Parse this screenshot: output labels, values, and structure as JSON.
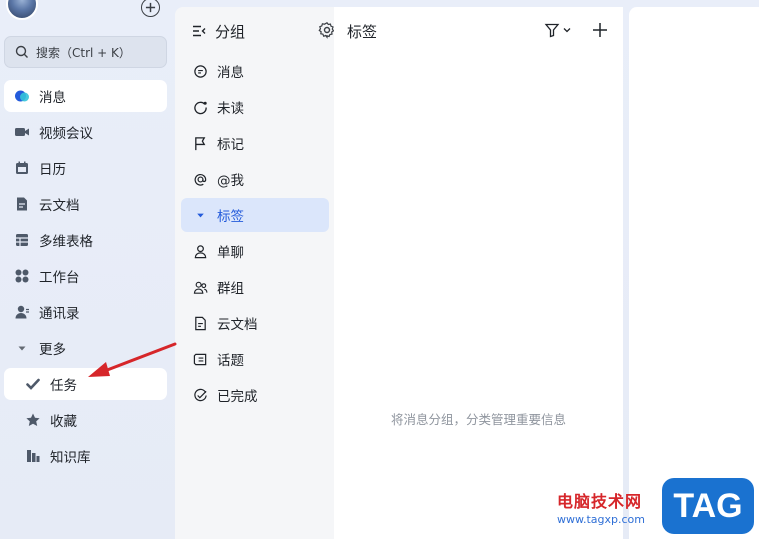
{
  "sidebar": {
    "search_placeholder": "搜索（Ctrl + K）",
    "items": [
      {
        "label": "消息",
        "icon": "message-bubble-icon"
      },
      {
        "label": "视频会议",
        "icon": "video-camera-icon"
      },
      {
        "label": "日历",
        "icon": "calendar-icon"
      },
      {
        "label": "云文档",
        "icon": "cloud-doc-icon"
      },
      {
        "label": "多维表格",
        "icon": "table-icon"
      },
      {
        "label": "工作台",
        "icon": "workspace-grid-icon"
      },
      {
        "label": "通讯录",
        "icon": "contacts-icon"
      },
      {
        "label": "更多",
        "icon": "triangle-down-icon"
      },
      {
        "label": "任务",
        "icon": "checkmark-task-icon"
      },
      {
        "label": "收藏",
        "icon": "star-icon"
      },
      {
        "label": "知识库",
        "icon": "knowledge-base-icon"
      }
    ]
  },
  "groups": {
    "title": "分组",
    "items": [
      {
        "label": "消息",
        "icon": "chat-icon"
      },
      {
        "label": "未读",
        "icon": "unread-circle-icon"
      },
      {
        "label": "标记",
        "icon": "flag-icon"
      },
      {
        "label": "@我",
        "icon": "at-icon"
      },
      {
        "label": "标签",
        "icon": "triangle-down-icon"
      },
      {
        "label": "单聊",
        "icon": "person-icon"
      },
      {
        "label": "群组",
        "icon": "group-people-icon"
      },
      {
        "label": "云文档",
        "icon": "document-icon"
      },
      {
        "label": "话题",
        "icon": "topic-icon"
      },
      {
        "label": "已完成",
        "icon": "done-check-icon"
      }
    ]
  },
  "content": {
    "title": "标签",
    "empty_text": "将消息分组，分类管理重要信息"
  },
  "watermark": {
    "text": "电脑技术网",
    "url": "www.tagxp.com",
    "badge": "TAG"
  },
  "colors": {
    "accent": "#245bdb",
    "active_bg": "#dbe6fb",
    "arrow": "#d6262a",
    "badge": "#1a72d0"
  }
}
